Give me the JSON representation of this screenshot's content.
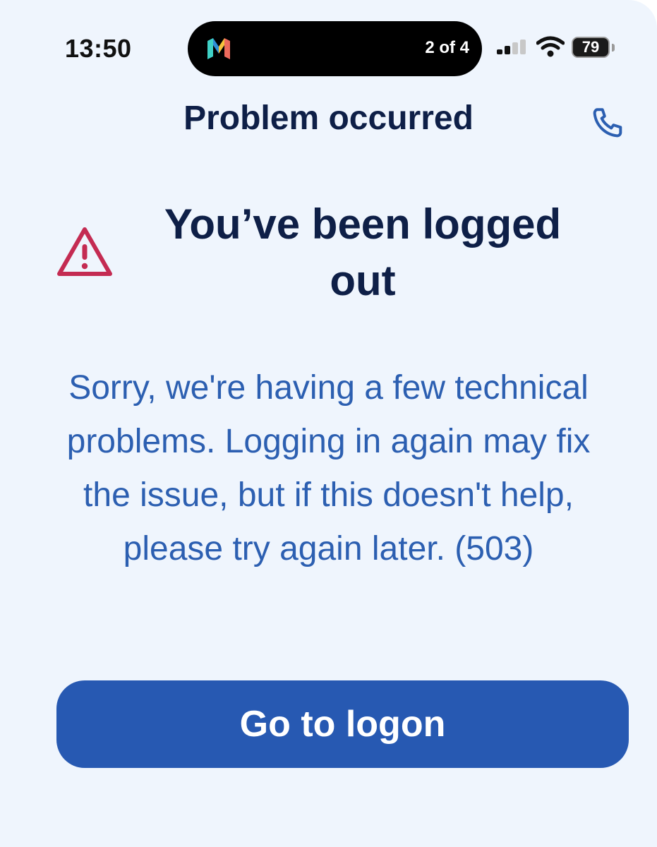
{
  "status_bar": {
    "time": "13:50",
    "app_logo_icon": "monzo-m-logo",
    "page_counter": "2 of 4",
    "signal_icon": "cellular-signal-icon",
    "wifi_icon": "wifi-icon",
    "battery_level": "79",
    "battery_fraction": 0.79
  },
  "header": {
    "title": "Problem occurred",
    "phone_icon": "phone-icon"
  },
  "error": {
    "icon": "warning-triangle-icon",
    "heading": "You’ve been logged out",
    "message": "Sorry, we're having a few technical problems. Logging in again may fix the issue, but if this doesn't help, please try again later. (503)"
  },
  "actions": {
    "logon_label": "Go to logon"
  },
  "colors": {
    "background": "#eff5fd",
    "title": "#0e1f47",
    "message": "#2c5fb1",
    "button": "#2759b2",
    "warning": "#c42b52"
  }
}
